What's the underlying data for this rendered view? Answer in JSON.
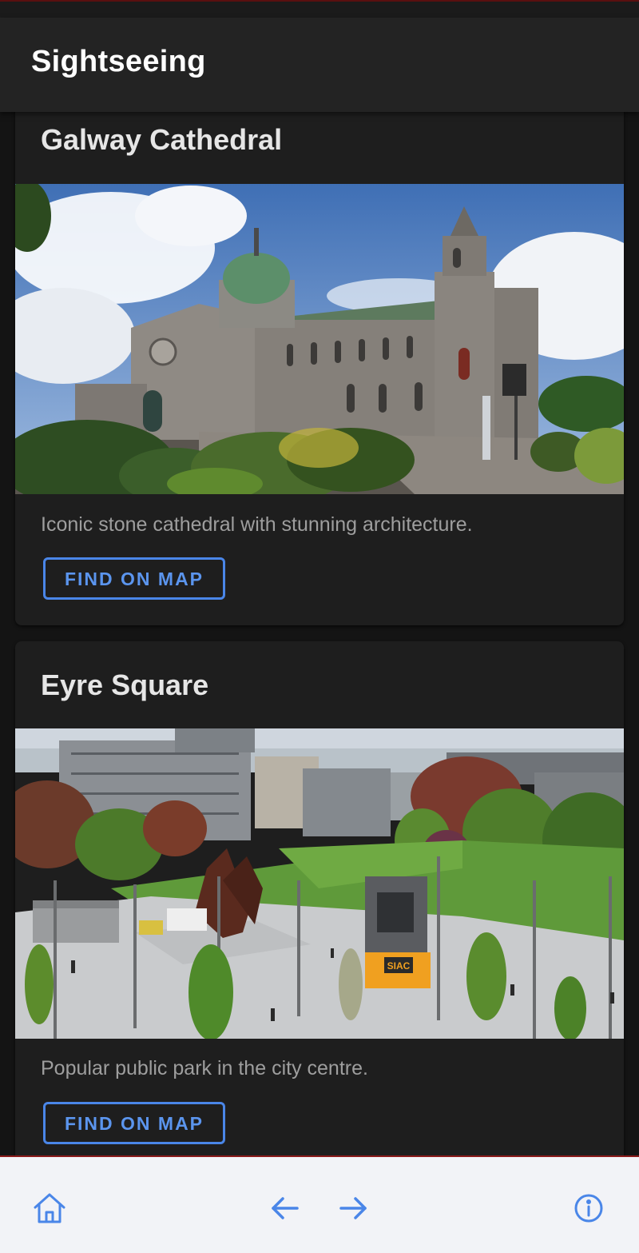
{
  "app": {
    "title": "Sightseeing"
  },
  "cards": [
    {
      "title": "Galway Cathedral",
      "description": "Iconic stone cathedral with stunning architecture.",
      "button": "FIND ON MAP"
    },
    {
      "title": "Eyre Square",
      "description": "Popular public park in the city centre.",
      "button": "FIND ON MAP",
      "sign_text": "SIAC"
    }
  ],
  "nav": {
    "icons": [
      "home-icon",
      "arrow-back-icon",
      "arrow-forward-icon",
      "info-icon"
    ],
    "accent": "#4a86e8"
  }
}
